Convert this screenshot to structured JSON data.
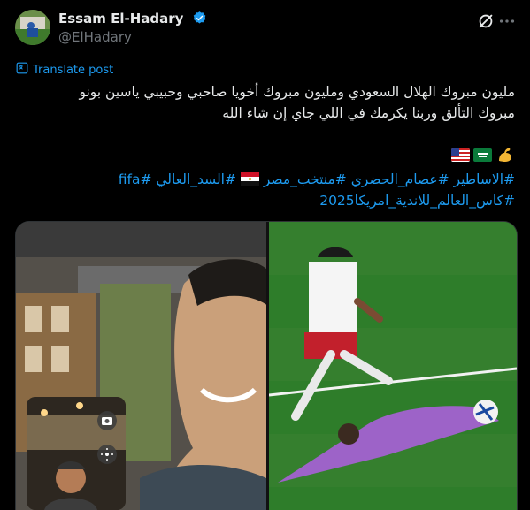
{
  "tweet": {
    "display_name": "Essam El-Hadary",
    "handle": "@ElHadary",
    "translate_label": "Translate post",
    "text_lines": [
      "مليون مبروك الهلال السعودي ومليون مبروك أخويا صاحبي وحبيبي ياسين بونو",
      "مبروك التألق وربنا يكرمك في اللي جاي إن شاء الله"
    ],
    "hashtags_line1": [
      "#الاساطير",
      "#عصام_الحضري",
      "#منتخب_مصر",
      "#السد_العالي",
      "#fifa"
    ],
    "hashtags_line2": [
      "#كاس_العالم_للاندية_امريكا2025"
    ],
    "flags": [
      "us-flag",
      "saudi-flag",
      "flexed-biceps"
    ],
    "egypt_flag": "egypt-flag"
  },
  "colors": {
    "background": "#000000",
    "text": "#e7e9ea",
    "secondary": "#71767b",
    "accent": "#1d9bf0"
  }
}
